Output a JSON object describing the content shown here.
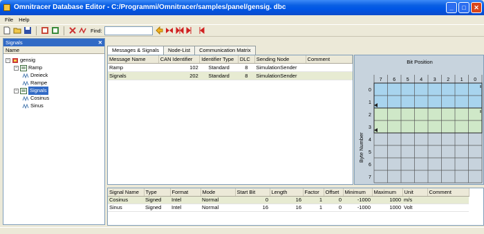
{
  "window": {
    "title": "Omnitracer Database Editor - C:/Programmi/Omnitracer/samples/panel/gensig. dbc"
  },
  "menu": [
    "File",
    "Help"
  ],
  "toolbar": {
    "find_label": "Find:",
    "find_value": ""
  },
  "left_pane": {
    "header": "Signals",
    "column": "Name",
    "tree": [
      {
        "label": "gensig",
        "depth": 0,
        "expander": "−",
        "icon": "database-icon",
        "selected": false
      },
      {
        "label": "Ramp",
        "depth": 1,
        "expander": "−",
        "icon": "message-icon",
        "selected": false
      },
      {
        "label": "Dreieck",
        "depth": 2,
        "expander": "",
        "icon": "signal-icon",
        "selected": false
      },
      {
        "label": "Rampe",
        "depth": 2,
        "expander": "",
        "icon": "signal-icon",
        "selected": false
      },
      {
        "label": "Signals",
        "depth": 1,
        "expander": "−",
        "icon": "message-icon",
        "selected": true
      },
      {
        "label": "Cosinus",
        "depth": 2,
        "expander": "",
        "icon": "signal-icon",
        "selected": false
      },
      {
        "label": "Sinus",
        "depth": 2,
        "expander": "",
        "icon": "signal-icon",
        "selected": false
      }
    ]
  },
  "tabs": [
    "Messages & Signals",
    "Node-List",
    "Communication Matrix"
  ],
  "messages": {
    "columns": [
      "Message Name",
      "CAN Identifier",
      "Identifier Type",
      "DLC",
      "Sending Node",
      "Comment"
    ],
    "rows": [
      [
        "Ramp",
        "102",
        "Standard",
        "8",
        "SimulationSender",
        ""
      ],
      [
        "Signals",
        "202",
        "Standard",
        "8",
        "SimulationSender",
        ""
      ]
    ]
  },
  "bit_grid": {
    "title": "Bit Position",
    "byte_label": "Byte Number",
    "bit_labels": [
      "7",
      "6",
      "5",
      "4",
      "3",
      "2",
      "1",
      "0"
    ],
    "byte_labels": [
      "0",
      "1",
      "2",
      "3",
      "4",
      "5",
      "6",
      "7"
    ],
    "signal_fills": [
      {
        "name": "Cosinus",
        "bytes": [
          0,
          1
        ],
        "color": "#a8d4ee"
      },
      {
        "name": "Sinus",
        "bytes": [
          2,
          3
        ],
        "color": "#cfe8c8"
      }
    ]
  },
  "signals": {
    "columns": [
      "Signal Name",
      "Type",
      "Format",
      "Mode",
      "Start Bit",
      "Length",
      "Factor",
      "Offset",
      "Minimum",
      "Maximum",
      "Unit",
      "Comment"
    ],
    "rows": [
      [
        "Cosinus",
        "Signed",
        "Intel",
        "Normal",
        "0",
        "16",
        "1",
        "0",
        "-1000",
        "1000",
        "m/s",
        ""
      ],
      [
        "Sinus",
        "Signed",
        "Intel",
        "Normal",
        "16",
        "16",
        "1",
        "0",
        "-1000",
        "1000",
        "Volt",
        ""
      ]
    ]
  },
  "colors": {
    "titlebar": "#0055e5",
    "selection": "#316ac5",
    "grid_bg": "#c7d3dd"
  }
}
